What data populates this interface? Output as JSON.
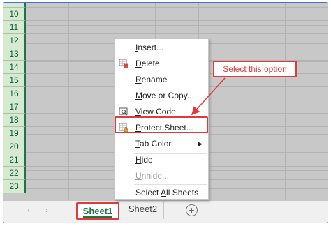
{
  "row_numbers": [
    "10",
    "11",
    "12",
    "13",
    "14",
    "15",
    "16",
    "17",
    "18",
    "19",
    "20",
    "21",
    "22",
    "23"
  ],
  "context_menu": {
    "items": [
      {
        "label": "Insert...",
        "icon": ""
      },
      {
        "label": "Delete",
        "icon": "delete-sheet-icon"
      },
      {
        "label": "Rename",
        "icon": ""
      },
      {
        "label": "Move or Copy...",
        "icon": ""
      },
      {
        "label": "View Code",
        "icon": "view-code-icon"
      },
      {
        "label": "Protect Sheet...",
        "icon": "protect-sheet-icon"
      },
      {
        "label": "Tab Color",
        "icon": "",
        "submenu": true
      },
      {
        "label": "Hide",
        "icon": ""
      },
      {
        "label": "Unhide...",
        "icon": "",
        "disabled": true
      },
      {
        "label": "Select All Sheets",
        "icon": ""
      }
    ]
  },
  "sheet_tabs": {
    "active": "Sheet1",
    "other": "Sheet2",
    "add_icon": "plus-circle-icon",
    "nav_prev": "‹",
    "nav_next": "›"
  },
  "annotation": {
    "text": "Select this option",
    "color": "#e03a3a"
  },
  "colors": {
    "accent": "#217346",
    "highlight": "#e03a3a",
    "grid_bg": "#c8c8c8"
  }
}
